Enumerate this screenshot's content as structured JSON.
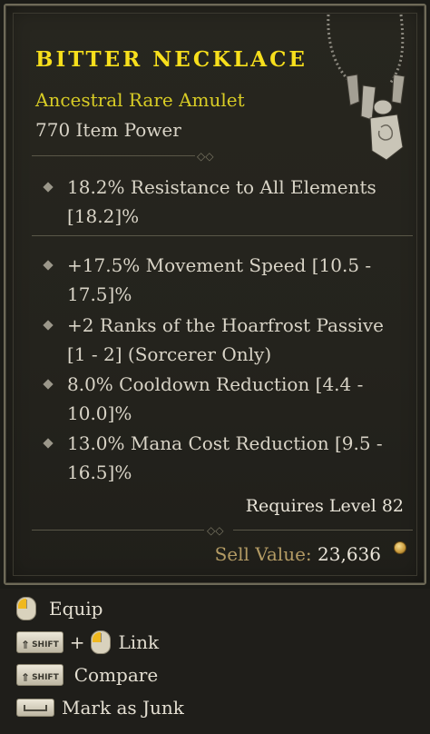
{
  "item": {
    "name": "Bitter Necklace",
    "type": "Ancestral Rare Amulet",
    "power": "770 Item Power",
    "image_icon": "amulet-necklace-icon"
  },
  "implicit_stats": [
    "18.2% Resistance to All Elements [18.2]%"
  ],
  "affixes": [
    "+17.5% Movement Speed [10.5 - 17.5]%",
    "+2 Ranks of the Hoarfrost Passive [1 - 2] (Sorcerer Only)",
    "8.0% Cooldown Reduction [4.4 - 10.0]%",
    "13.0% Mana Cost Reduction [9.5 - 16.5]%"
  ],
  "requirement": "Requires Level 82",
  "sell": {
    "label": "Sell Value:",
    "value": "23,636",
    "icon": "gold-coin-icon"
  },
  "actions": {
    "equip": {
      "label": "Equip",
      "icon": "right-mouse-icon"
    },
    "link": {
      "key": "SHIFT",
      "plus": "+",
      "label": "Link",
      "icon": "right-mouse-icon"
    },
    "compare": {
      "key": "SHIFT",
      "label": "Compare"
    },
    "junk": {
      "label": "Mark as Junk",
      "icon": "spacebar-key-icon"
    }
  },
  "colors": {
    "name": "#f7df1c",
    "type": "#d8cc25",
    "text": "#d9d4c7",
    "sell_label": "#b39b64"
  }
}
